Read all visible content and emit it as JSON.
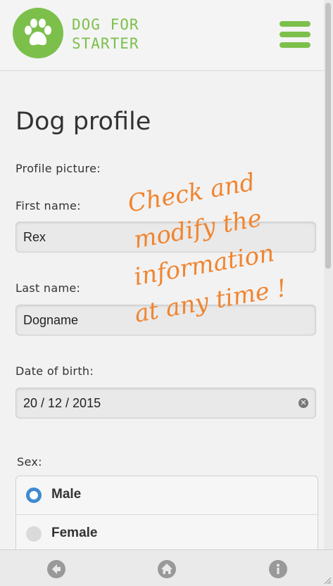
{
  "brand": {
    "line1": "DOG FOR",
    "line2": "STARTER",
    "accent": "#7cc04b",
    "logo_icon": "paw-icon"
  },
  "header": {
    "menu_icon": "hamburger-menu-icon"
  },
  "page": {
    "title": "Dog profile"
  },
  "form": {
    "profile_picture_label": "Profile picture:",
    "first_name": {
      "label": "First name:",
      "value": "Rex"
    },
    "last_name": {
      "label": "Last name:",
      "value": "Dogname"
    },
    "date_of_birth": {
      "label": "Date of birth:",
      "value": "20 / 12 / 2015",
      "clear_icon": "clear-icon"
    },
    "sex": {
      "label": "Sex:",
      "options": [
        {
          "label": "Male",
          "selected": true
        },
        {
          "label": "Female",
          "selected": false
        }
      ],
      "selected_color": "#3d8ad1"
    }
  },
  "annotation": {
    "lines": [
      "Check and",
      "modify the",
      "information",
      "at any time !"
    ],
    "color": "#f08530"
  },
  "footer": {
    "icons": [
      "back-arrow-icon",
      "home-icon",
      "info-icon"
    ]
  }
}
